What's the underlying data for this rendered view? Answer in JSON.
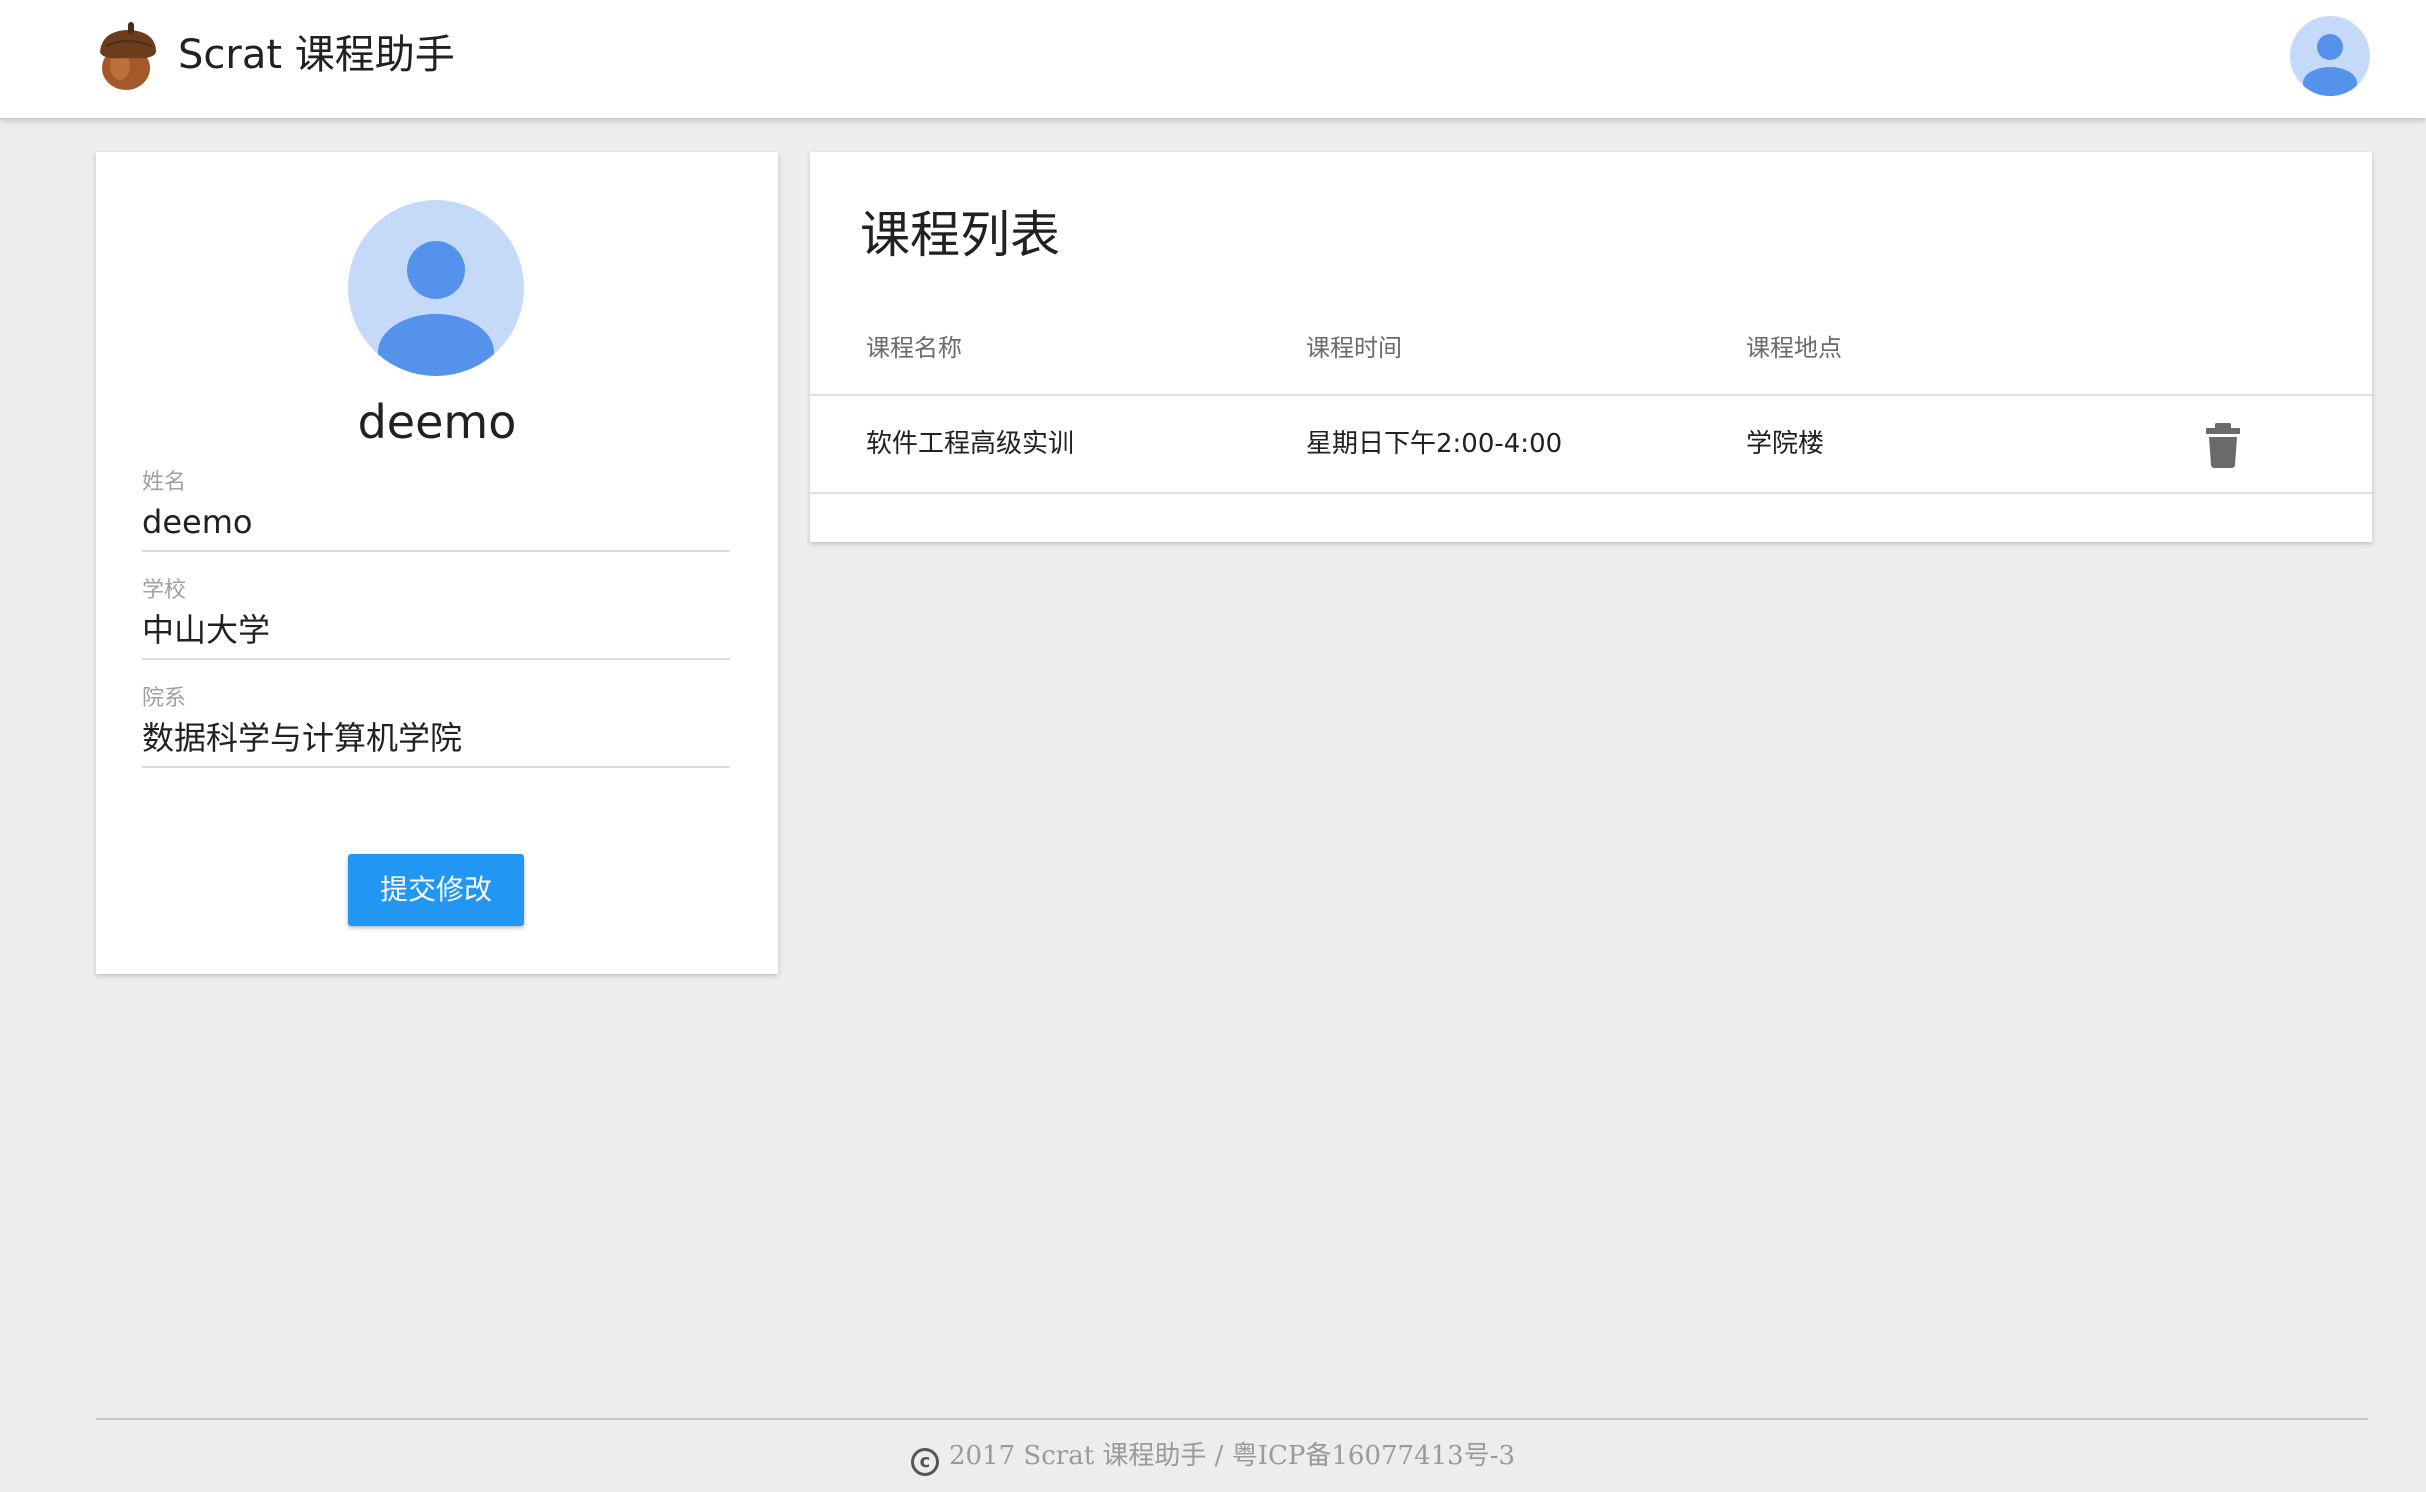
{
  "header": {
    "app_title": "Scrat 课程助手",
    "logo_icon": "acorn-icon",
    "user_icon": "user-avatar-icon"
  },
  "profile": {
    "username": "deemo",
    "fields": [
      {
        "label": "姓名",
        "value": "deemo"
      },
      {
        "label": "学校",
        "value": "中山大学"
      },
      {
        "label": "院系",
        "value": "数据科学与计算机学院"
      }
    ],
    "submit_label": "提交修改"
  },
  "courses": {
    "title": "课程列表",
    "columns": [
      "课程名称",
      "课程时间",
      "课程地点"
    ],
    "rows": [
      {
        "name": "软件工程高级实训",
        "time": "星期日下午2:00-4:00",
        "location": "学院楼",
        "action_icon": "trash-icon"
      }
    ]
  },
  "footer": {
    "text": "2017 Scrat 课程助手 / 粤ICP备16077413号-3",
    "copyright_symbol": "©"
  },
  "colors": {
    "primary": "#2196f3",
    "avatar_bg": "#c5d9f8",
    "avatar_fg": "#5592ec",
    "background": "#ededed"
  }
}
